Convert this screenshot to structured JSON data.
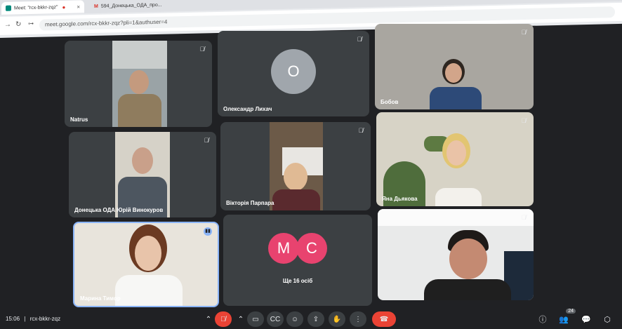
{
  "browser": {
    "tabs": [
      {
        "title": "Meet: \"rcx-bkkr-zqz\""
      },
      {
        "title": "594_Донецька_ОДА_про..."
      }
    ],
    "url": "meet.google.com/rcx-bkkr-zqz?pli=1&authuser=4"
  },
  "tiles": [
    {
      "name": "Natrus",
      "muted": true
    },
    {
      "name": "Олександр Лихач",
      "avatar": "О",
      "muted": true
    },
    {
      "name": "Бобов",
      "muted": true
    },
    {
      "name": "Донецька ОДА Юрій Винокуров",
      "muted": true
    },
    {
      "name": "Вікторія Парпара",
      "muted": true
    },
    {
      "name": "Яна Дьякова",
      "muted": true
    },
    {
      "name": "Марина Тимор",
      "speaking": true
    },
    {
      "avatars": [
        "М",
        "С"
      ],
      "label": "Ще 16 осіб"
    },
    {
      "name": "",
      "muted": true
    }
  ],
  "bottom_bar": {
    "time": "15:06",
    "meeting_code": "rcx-bkkr-zqz",
    "participants_count": "24"
  },
  "colors": {
    "accent_blue": "#8ab4f8",
    "avatar_grey": "#a0a6ac",
    "avatar_pink": "#e8436f",
    "end_call": "#ea4335"
  }
}
